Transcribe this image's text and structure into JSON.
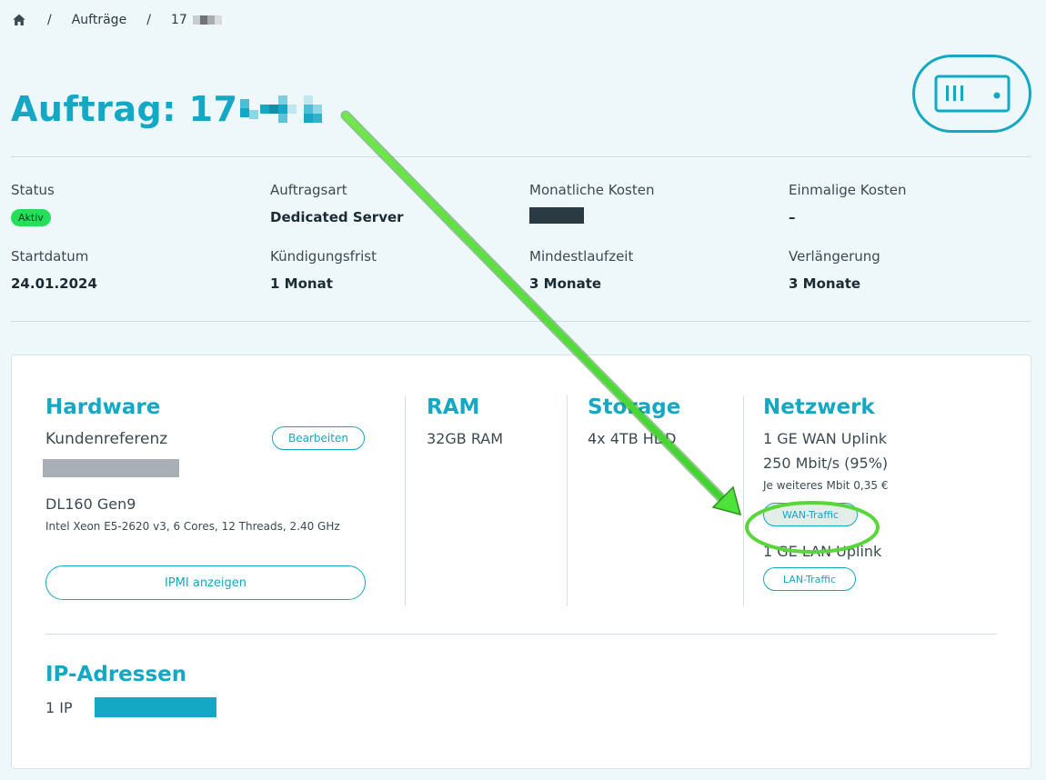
{
  "breadcrumb": {
    "items": [
      "Aufträge",
      "17"
    ],
    "separator": "/"
  },
  "page": {
    "title_prefix": "Auftrag: 17"
  },
  "info": {
    "status": {
      "label": "Status",
      "value": "Aktiv"
    },
    "auftragsart": {
      "label": "Auftragsart",
      "value": "Dedicated Server"
    },
    "monatliche_kosten": {
      "label": "Monatliche Kosten"
    },
    "einmalige_kosten": {
      "label": "Einmalige Kosten",
      "value": "–"
    },
    "startdatum": {
      "label": "Startdatum",
      "value": "24.01.2024"
    },
    "kuendigungsfrist": {
      "label": "Kündigungsfrist",
      "value": "1 Monat"
    },
    "mindestlaufzeit": {
      "label": "Mindestlaufzeit",
      "value": "3 Monate"
    },
    "verlaengerung": {
      "label": "Verlängerung",
      "value": "3 Monate"
    }
  },
  "hardware": {
    "title": "Hardware",
    "kundenreferenz_label": "Kundenreferenz",
    "edit_button": "Bearbeiten",
    "model": "DL160 Gen9",
    "cpu": "Intel Xeon E5-2620 v3, 6 Cores, 12 Threads, 2.40 GHz",
    "ipmi_button": "IPMI anzeigen"
  },
  "ram": {
    "title": "RAM",
    "value": "32GB RAM"
  },
  "storage": {
    "title": "Storage",
    "value": "4x 4TB HDD"
  },
  "network": {
    "title": "Netzwerk",
    "wan_uplink": "1 GE WAN Uplink",
    "bandwidth": "250 Mbit/s (95%)",
    "extra_cost": "Je weiteres Mbit 0,35 €",
    "wan_button": "WAN-Traffic",
    "lan_uplink": "1 GE LAN Uplink",
    "lan_button": "LAN-Traffic"
  },
  "ip": {
    "title": "IP-Adressen",
    "count": "1 IP"
  },
  "colors": {
    "accent": "#14a8c4",
    "status_active": "#22e05a",
    "annotation_arrow": "#4ee23a"
  },
  "icons": {
    "home": "home-icon",
    "server": "server-icon"
  }
}
